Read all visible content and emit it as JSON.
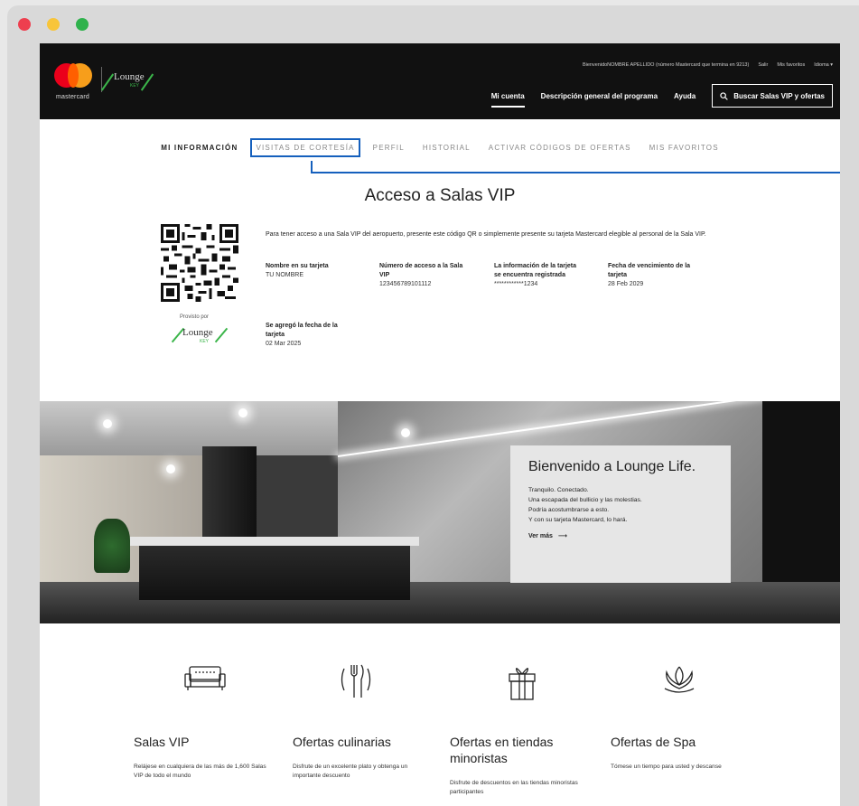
{
  "browser": {
    "controls": [
      "close",
      "minimize",
      "maximize"
    ]
  },
  "header": {
    "brand": "mastercard",
    "partner_logo": {
      "word": "Lounge",
      "sub": "KEY"
    },
    "top_links": {
      "welcome": "BienvenidoNOMBRE APELLIDO (número Mastercard que termina en 9213)",
      "logout": "Salir",
      "favorites": "Mis favoritos",
      "language": "Idioma ▾"
    },
    "nav": {
      "account": "Mi cuenta",
      "overview": "Descripción general del programa",
      "help": "Ayuda",
      "search": "Buscar Salas VIP y ofertas"
    }
  },
  "tabs": [
    "MI INFORMACIÓN",
    "VISITAS DE CORTESÍA",
    "PERFIL",
    "HISTORIAL",
    "ACTIVAR CÓDIGOS DE OFERTAS",
    "MIS FAVORITOS"
  ],
  "access": {
    "title": "Acceso a Salas VIP",
    "intro": "Para tener acceso a una Sala VIP del aeropuerto, presente este código QR o simplemente presente su tarjeta Mastercard elegible al personal de la Sala VIP.",
    "provided_by": "Provisto por",
    "fields": [
      {
        "label": "Nombre en su tarjeta",
        "value": "TU NOMBRE"
      },
      {
        "label": "Número de acceso a la Sala VIP",
        "value": "123456789101112"
      },
      {
        "label": "La información de la tarjeta se encuentra registrada",
        "value": "************1234"
      },
      {
        "label": "Fecha de vencimiento de la tarjeta",
        "value": "28 Feb 2029"
      },
      {
        "label": "Se agregó la fecha de la tarjeta",
        "value": "02 Mar 2025"
      }
    ]
  },
  "hero": {
    "title": "Bienvenido a Lounge Life.",
    "lines": [
      "Tranquilo. Conectado.",
      "Una escapada del bullicio y las molestias.",
      "Podría acostumbrarse a esto.",
      "Y con su tarjeta Mastercard, lo hará."
    ],
    "cta": "Ver más",
    "cta_arrow": "⟶"
  },
  "features": [
    {
      "icon": "sofa-icon",
      "title": "Salas VIP",
      "desc": "Relájese en cualquiera de las más de 1,600 Salas VIP de todo el mundo"
    },
    {
      "icon": "dining-icon",
      "title": "Ofertas culinarias",
      "desc": "Disfrute de un excelente plato y obtenga un importante descuento"
    },
    {
      "icon": "gift-icon",
      "title": "Ofertas en tiendas minoristas",
      "desc": "Disfrute de descuentos en las tiendas minoristas participantes"
    },
    {
      "icon": "lotus-icon",
      "title": "Ofertas de Spa",
      "desc": "Tómese un tiempo para usted y descanse"
    }
  ],
  "colors": {
    "header_bg": "#111111",
    "highlight": "#1560bd",
    "mc_red": "#eb001b",
    "mc_orange": "#f79e1b",
    "lounge_green": "#3bb54a"
  }
}
